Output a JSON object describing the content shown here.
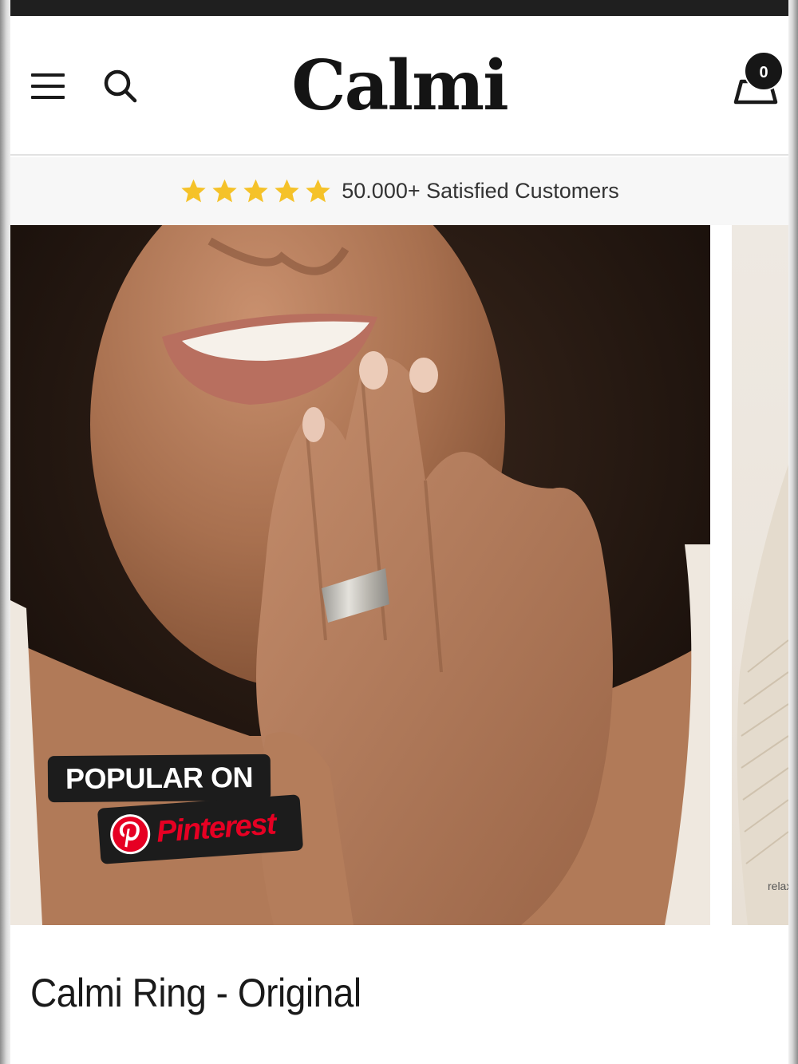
{
  "header": {
    "brand": "Calmi",
    "cart_count": "0"
  },
  "rating_bar": {
    "stars": 5,
    "text": "50.000+ Satisfied Customers",
    "star_color": "#F5C229"
  },
  "carousel": {
    "badge_line1": "POPULAR ON",
    "badge_line2": "Pinterest",
    "next_slide_caption": "relax"
  },
  "product": {
    "title": "Calmi Ring - Original"
  },
  "colors": {
    "brand_text": "#141414",
    "pinterest_red": "#E60023",
    "badge_bg": "#1C1C1C"
  }
}
